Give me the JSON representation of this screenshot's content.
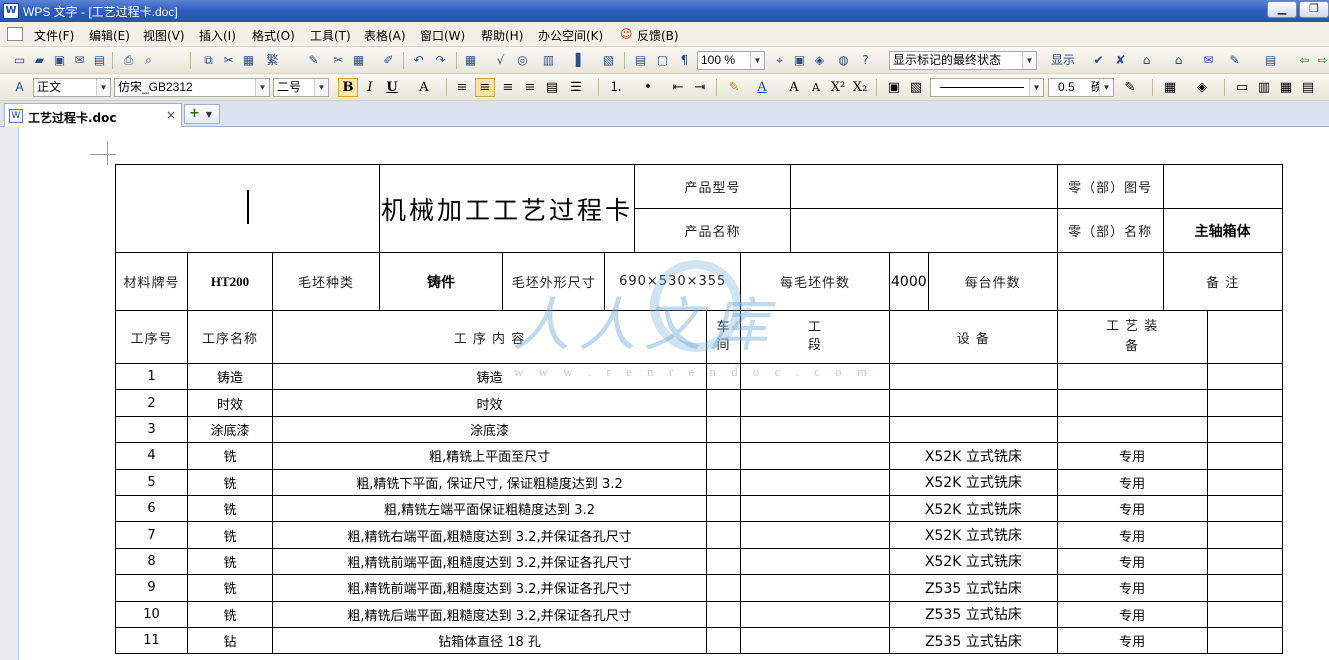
{
  "window": {
    "app_icon": "W",
    "title": "WPS 文字 - [工艺过程卡.doc]"
  },
  "menu": {
    "items": [
      "文件(F)",
      "编辑(E)",
      "视图(V)",
      "插入(I)",
      "格式(O)",
      "工具(T)",
      "表格(A)",
      "窗口(W)",
      "帮助(H)",
      "办公空间(K)",
      "反馈(B)"
    ]
  },
  "toolbar": {
    "zoom": "100 %",
    "markup_state": "显示标记的最终状态",
    "display_label": "显示"
  },
  "format": {
    "style": "正文",
    "font": "仿宋_GB2312",
    "size": "二号",
    "line_weight": "0.5",
    "line_unit": "磅"
  },
  "tabs": {
    "doc_name": "工艺过程卡.doc",
    "close": "×",
    "add": "+"
  },
  "card": {
    "title": "机械加工工艺过程卡",
    "product_model_label": "产品型号",
    "part_no_label": "零（部）图号",
    "product_name_label": "产品名称",
    "part_name_label": "零（部）名称",
    "part_name": "主轴箱体",
    "material_label": "材料牌号",
    "material": "HT200",
    "blank_type_label": "毛坯种类",
    "blank_type": "铸件",
    "blank_size_label": "毛坯外形尺寸",
    "blank_size": "690×530×355",
    "parts_per_blank_label": "每毛坯件数",
    "parts_per_blank": "4000",
    "per_unit_label": "每台件数",
    "remark_label": "备  注"
  },
  "columns": {
    "seq": "工序号",
    "name": "工序名称",
    "content": "工      序      内      容",
    "workshop": "车\n间",
    "section": "工\n段",
    "equipment": "设   备",
    "tooling": "工      艺      装\n备"
  },
  "rows": [
    {
      "seq": "1",
      "name": "铸造",
      "content": "铸造",
      "equipment": "",
      "tooling": ""
    },
    {
      "seq": "2",
      "name": "时效",
      "content": "时效",
      "equipment": "",
      "tooling": ""
    },
    {
      "seq": "3",
      "name": "涂底漆",
      "content": "涂底漆",
      "equipment": "",
      "tooling": ""
    },
    {
      "seq": "4",
      "name": "铣",
      "content": "粗,精铣上平面至尺寸",
      "equipment": "X52K 立式铣床",
      "tooling": "专用"
    },
    {
      "seq": "5",
      "name": "铣",
      "content": "粗,精铣下平面, 保证尺寸, 保证粗糙度达到 3.2",
      "equipment": "X52K 立式铣床",
      "tooling": "专用"
    },
    {
      "seq": "6",
      "name": "铣",
      "content": "粗,精铣左端平面保证粗糙度达到 3.2",
      "equipment": "X52K 立式铣床",
      "tooling": "专用"
    },
    {
      "seq": "7",
      "name": "铣",
      "content": "粗,精铣右端平面,粗糙度达到 3.2,并保证各孔尺寸",
      "equipment": "X52K 立式铣床",
      "tooling": "专用"
    },
    {
      "seq": "8",
      "name": "铣",
      "content": "粗,精铣前端平面,粗糙度达到 3.2,并保证各孔尺寸",
      "equipment": "X52K 立式铣床",
      "tooling": "专用"
    },
    {
      "seq": "9",
      "name": "铣",
      "content": "粗,精铣前端平面,粗糙度达到 3.2,并保证各孔尺寸",
      "equipment": "Z535 立式钻床",
      "tooling": "专用"
    },
    {
      "seq": "10",
      "name": "铣",
      "content": "粗,精铣后端平面,粗糙度达到 3.2,并保证各孔尺寸",
      "equipment": "Z535 立式钻床",
      "tooling": "专用"
    },
    {
      "seq": "11",
      "name": "钻",
      "content": "钻箱体直径 18 孔",
      "equipment": "Z535 立式钻床",
      "tooling": "专用"
    }
  ],
  "watermark": {
    "text": "人人文库",
    "url": "w w w . r e n r e n d o c . c o m"
  }
}
